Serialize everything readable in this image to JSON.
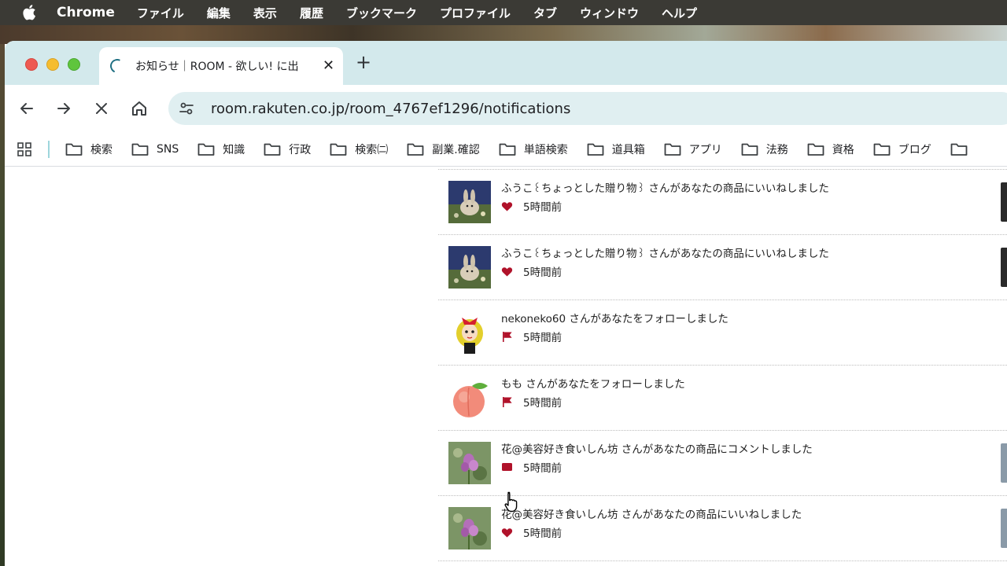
{
  "menubar": {
    "app_name": "Chrome",
    "items": [
      "ファイル",
      "編集",
      "表示",
      "履歴",
      "ブックマーク",
      "プロファイル",
      "タブ",
      "ウィンドウ",
      "ヘルプ"
    ]
  },
  "tab": {
    "title": "お知らせ｜ROOM - 欲しい! に出",
    "close": "✕"
  },
  "new_tab": "+",
  "address_bar": {
    "url": "room.rakuten.co.jp/room_4767ef1296/notifications"
  },
  "bookmarks": [
    "検索",
    "SNS",
    "知識",
    "行政",
    "検索㈡",
    "副業.確認",
    "単語検索",
    "道具箱",
    "アプリ",
    "法務",
    "資格",
    "ブログ"
  ],
  "notifications": [
    {
      "message": "",
      "time": "5時間前",
      "kind": "heart-icon",
      "avatar": "rabbit"
    },
    {
      "message": "ふうこ꒰ちょっとした贈り物꒱ さんがあなたの商品にいいねしました",
      "time": "5時間前",
      "kind": "heart-icon",
      "avatar": "rabbit"
    },
    {
      "message": "ふうこ꒰ちょっとした贈り物꒱ さんがあなたの商品にいいねしました",
      "time": "5時間前",
      "kind": "heart-icon",
      "avatar": "rabbit"
    },
    {
      "message": "nekoneko60 さんがあなたをフォローしました",
      "time": "5時間前",
      "kind": "flag-icon",
      "avatar": "girl"
    },
    {
      "message": "もも さんがあなたをフォローしました",
      "time": "5時間前",
      "kind": "flag-icon",
      "avatar": "peach"
    },
    {
      "message": "花@美容好き食いしん坊 さんがあなたの商品にコメントしました",
      "time": "5時間前",
      "kind": "comment-icon",
      "avatar": "flower"
    },
    {
      "message": "花@美容好き食いしん坊 さんがあなたの商品にいいねしました",
      "time": "5時間前",
      "kind": "heart-icon",
      "avatar": "flower"
    }
  ],
  "colors": {
    "tabstrip": "#d3e9ec",
    "omnibox": "#e0eff1",
    "accent_red": "#b0122a",
    "menubar": "#3b3a35"
  }
}
